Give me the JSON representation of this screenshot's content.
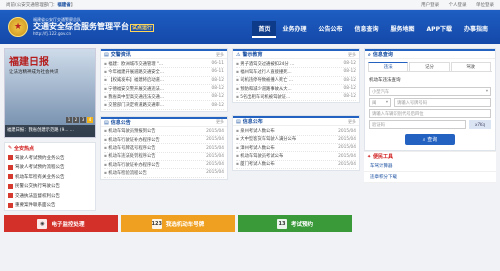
{
  "topbar": {
    "left_prefix": "尚前(公安交通管理部门：",
    "left_city": "福建省",
    "left_suffix": "】",
    "user_login": "用户登录",
    "personal": "个人登录",
    "unit": "单位登录"
  },
  "header": {
    "subtitle": "福建省公安厅交通警察总队",
    "title": "交通安全综合服务管理平台",
    "badge": "试点运行",
    "url": "http://fj.122.gov.cn",
    "nav": [
      "首页",
      "业务办理",
      "公告公布",
      "信息查询",
      "服务地图",
      "APP下载",
      "办事指南"
    ]
  },
  "banner": {
    "paper": "福建日报",
    "headline": "让法治精神成为社会共识",
    "caption": "福建日报：我省创建示范路 (9... ...",
    "pages": [
      "1",
      "2",
      "3",
      "4"
    ]
  },
  "traffic_info": {
    "title": "交警资讯",
    "more": "更多",
    "items": [
      {
        "t": "福建：欧洲城市交通管理 \"...",
        "d": "06-11"
      },
      {
        "t": "今年福建开展道路交通安全...",
        "d": "06-11"
      },
      {
        "t": "【权威发布】福建将启动道...",
        "d": "08-12"
      },
      {
        "t": "宁德福安交警开展交通违法...",
        "d": "08-12"
      },
      {
        "t": "我省高中型高交通违法交通...",
        "d": "08-12"
      },
      {
        "t": "交管部门决定将道路交通审...",
        "d": "08-12"
      }
    ]
  },
  "police_notice": {
    "title": "警示教育",
    "more": "更多",
    "items": [
      {
        "t": "男子酒驾交过通被扣24分 ...",
        "d": "08-12"
      },
      {
        "t": "福州驾车过行人直接撞死...",
        "d": "08-12"
      },
      {
        "t": "司机违停导致被撞人死亡 ...",
        "d": "08-12"
      },
      {
        "t": "预防和减少道路事故从大...",
        "d": "08-12"
      },
      {
        "t": "5名出租车司机被驾驶证...",
        "d": "08-12"
      }
    ]
  },
  "topics": {
    "title": "全安热点",
    "items": [
      "驾驶人考试预约业务公告",
      "驾驶人考试预约流程公告",
      "机动车年检有关业务公告",
      "民警公交执行驾驶公告",
      "交通执法监督权利公告",
      "重要案件联系面公告"
    ]
  },
  "info_notice": {
    "title": "信息公告",
    "more": "更多",
    "items": [
      {
        "t": "机动车驾驶员预报到公告",
        "d": "2015/04"
      },
      {
        "t": "机动车行驶证补办程序公告",
        "d": "2015/04"
      },
      {
        "t": "机动车号牌选号程序公告",
        "d": "2015/04"
      },
      {
        "t": "机动车违法处罚程序公告",
        "d": "2015/04"
      },
      {
        "t": "机动车行驶证补办程序公告",
        "d": "2015/04"
      },
      {
        "t": "机动车检验流程公告",
        "d": "2015/04"
      }
    ]
  },
  "info_publish": {
    "title": "信息公布",
    "more": "更多",
    "items": [
      {
        "t": "泉州考试人数公布",
        "d": "2015/04"
      },
      {
        "t": "大中型客货车驾驶人满分公布",
        "d": "2015/04"
      },
      {
        "t": "漳州考试人数公布",
        "d": "2015/04"
      },
      {
        "t": "机动车驾驶员考试公布",
        "d": "2015/04"
      },
      {
        "t": "厦门考试人数公布",
        "d": "2015/04"
      }
    ]
  },
  "query": {
    "title": "信息查询",
    "tabs": [
      "违法",
      "记分",
      "驾驶"
    ],
    "label": "机动车违法查询",
    "type_value": "小型汽车",
    "province": "闽",
    "plate_placeholder": "请输入号牌号码",
    "vin_placeholder": "请输入车辆识别代号后四位",
    "captcha_placeholder": "验证码",
    "captcha_img": "x7Kq",
    "search_btn": "查询"
  },
  "tools": {
    "title": "便民工具",
    "items": [
      "车驾计算器",
      "违章积分下载"
    ]
  },
  "tiles": [
    {
      "label": "电子监控处理",
      "icon": "camera-icon",
      "glyph": "◉",
      "color": "#d3302a"
    },
    {
      "label": "我选机动车号牌",
      "icon": "plate-icon",
      "glyph": "123",
      "color": "#f0a020"
    },
    {
      "label": "考试预约",
      "icon": "calendar-icon",
      "glyph": "13",
      "color": "#3a9a3a"
    }
  ]
}
